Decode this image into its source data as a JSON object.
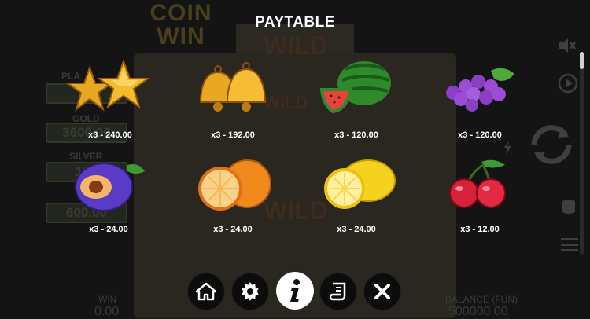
{
  "title": "PAYTABLE",
  "background": {
    "logo_line1": "COIN",
    "logo_line2": "WIN",
    "wild_text": "WILD",
    "jackpot_label_platinum": "PLA",
    "jackpot_value_platinum": "24",
    "jackpot_label_gold": "GOLD",
    "jackpot_value_gold": "3600.00",
    "jackpot_label_silver": "SILVER",
    "jackpot_value_silver": "120",
    "jackpot_value_bronze": "600.00",
    "win_label": "WIN",
    "win_value": "0.00",
    "balance_label": "BALANCE (FUN)",
    "balance_value": "500000.00"
  },
  "symbols": [
    {
      "name": "stars",
      "payout": "x3 - 240.00"
    },
    {
      "name": "bells",
      "payout": "x3 - 192.00"
    },
    {
      "name": "watermelon",
      "payout": "x3 - 120.00"
    },
    {
      "name": "grapes",
      "payout": "x3 - 120.00"
    },
    {
      "name": "plum",
      "payout": "x3 - 24.00"
    },
    {
      "name": "orange",
      "payout": "x3 - 24.00"
    },
    {
      "name": "lemon",
      "payout": "x3 - 24.00"
    },
    {
      "name": "cherries",
      "payout": "x3 - 12.00"
    }
  ],
  "nav": [
    {
      "icon": "home-icon"
    },
    {
      "icon": "gear-icon"
    },
    {
      "icon": "info-icon",
      "active": true
    },
    {
      "icon": "scroll-icon"
    },
    {
      "icon": "close-icon"
    }
  ],
  "colors": {
    "background": "#141414",
    "text": "#ffffff",
    "active_button": "#ffffff",
    "button": "#0c0c0c"
  }
}
